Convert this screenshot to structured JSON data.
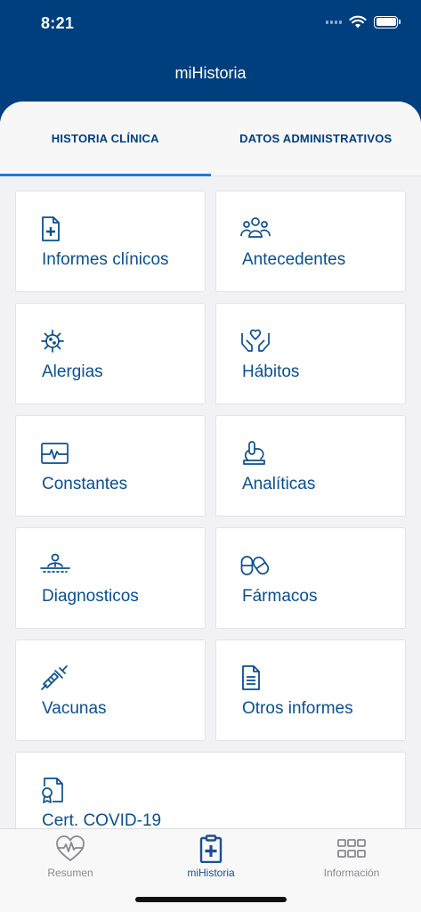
{
  "status": {
    "time": "8:21"
  },
  "nav": {
    "title": "miHistoria"
  },
  "tabs": [
    {
      "label": "HISTORIA CLÍNICA",
      "active": true
    },
    {
      "label": "DATOS ADMINISTRATIVOS",
      "active": false
    }
  ],
  "cards": [
    {
      "label": "Informes clínicos",
      "icon": "medical-document-icon"
    },
    {
      "label": "Antecedentes",
      "icon": "family-group-icon"
    },
    {
      "label": "Alergias",
      "icon": "allergen-virus-icon"
    },
    {
      "label": "Hábitos",
      "icon": "hands-heart-icon"
    },
    {
      "label": "Constantes",
      "icon": "heart-monitor-icon"
    },
    {
      "label": "Analíticas",
      "icon": "microscope-icon"
    },
    {
      "label": "Diagnosticos",
      "icon": "patient-diagnosis-icon"
    },
    {
      "label": "Fármacos",
      "icon": "pills-icon"
    },
    {
      "label": "Vacunas",
      "icon": "syringe-icon"
    },
    {
      "label": "Otros informes",
      "icon": "document-icon"
    },
    {
      "label": "Cert. COVID-19",
      "icon": "certificate-icon"
    }
  ],
  "tabbar": [
    {
      "label": "Resumen",
      "icon": "heartbeat-icon",
      "active": false
    },
    {
      "label": "miHistoria",
      "icon": "clipboard-medical-icon",
      "active": true
    },
    {
      "label": "Información",
      "icon": "grid-icon",
      "active": false
    }
  ],
  "colors": {
    "primary": "#003f7d",
    "accent": "#1c7ad2",
    "card_text": "#0b4f8f",
    "inactive": "#8a8a8e"
  }
}
